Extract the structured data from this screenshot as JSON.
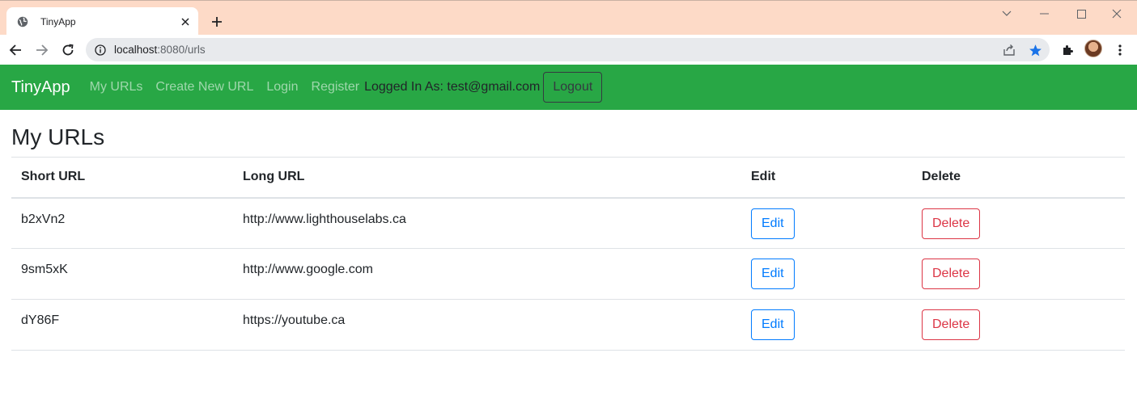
{
  "browser": {
    "tab_title": "TinyApp",
    "url_host": "localhost",
    "url_rest": ":8080/urls",
    "accent": "#fddac7"
  },
  "navbar": {
    "brand": "TinyApp",
    "links": [
      "My URLs",
      "Create New URL",
      "Login",
      "Register"
    ],
    "logged_in_text": "Logged In As: test@gmail.com",
    "logout_label": "Logout",
    "color": "#28a745"
  },
  "main": {
    "title": "My URLs",
    "columns": [
      "Short URL",
      "Long URL",
      "Edit",
      "Delete"
    ],
    "rows": [
      {
        "short": "b2xVn2",
        "long": "http://www.lighthouselabs.ca",
        "edit": "Edit",
        "delete": "Delete"
      },
      {
        "short": "9sm5xK",
        "long": "http://www.google.com",
        "edit": "Edit",
        "delete": "Delete"
      },
      {
        "short": "dY86F",
        "long": "https://youtube.ca",
        "edit": "Edit",
        "delete": "Delete"
      }
    ]
  },
  "icons": [
    "globe-icon",
    "close-icon",
    "plus-icon",
    "chevron-down-icon",
    "minimize-icon",
    "maximize-icon",
    "window-close-icon",
    "back-icon",
    "forward-icon",
    "reload-icon",
    "info-icon",
    "share-icon",
    "star-icon",
    "extensions-icon",
    "menu-icon"
  ]
}
